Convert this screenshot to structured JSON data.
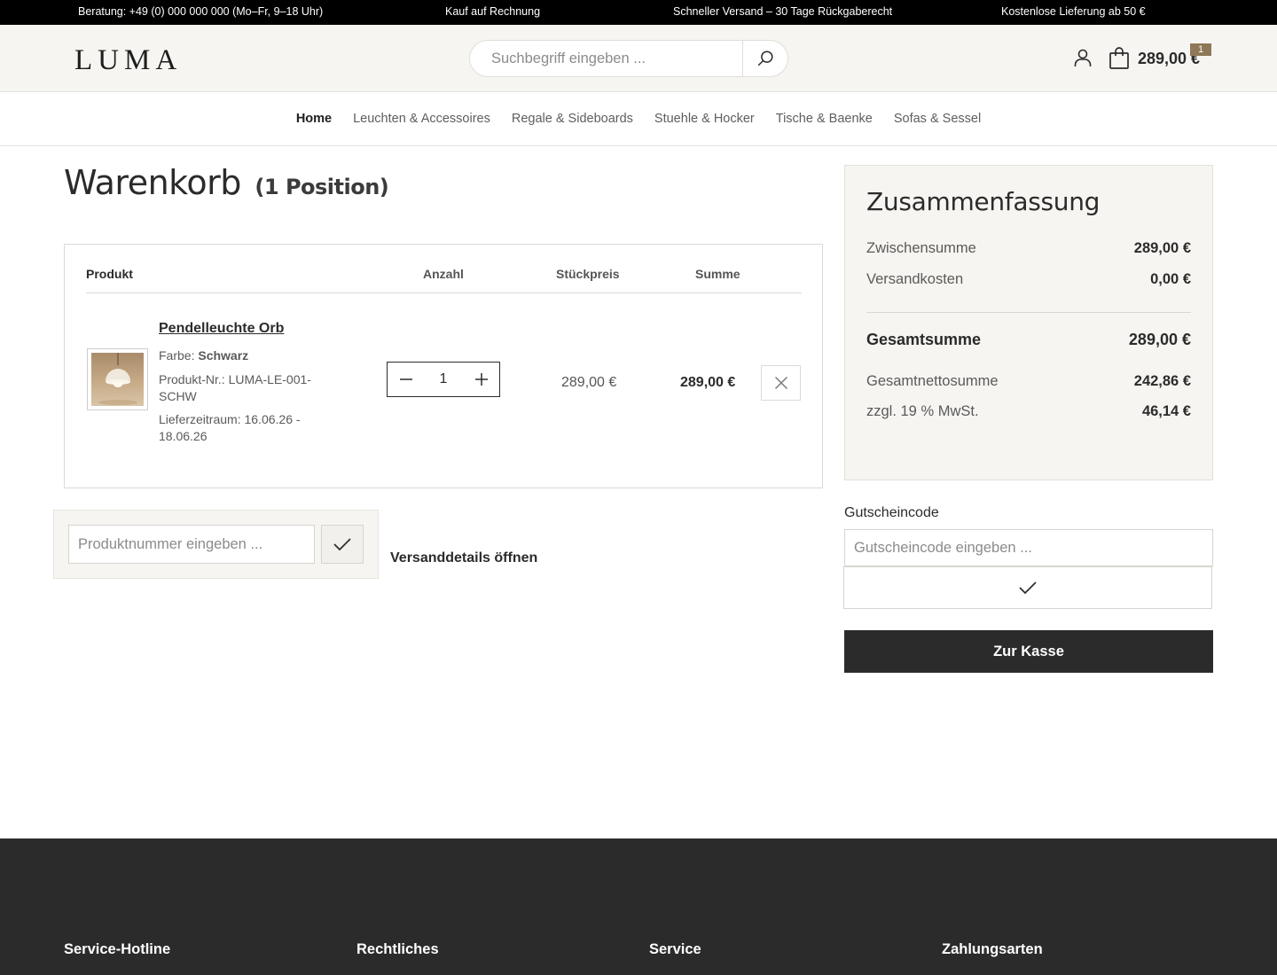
{
  "topbar": {
    "hotline": "Beratung: +49 (0) 000 000 000 (Mo–Fr, 9–18 Uhr)",
    "invoice": "Kauf auf Rechnung",
    "shipping": "Schneller Versand – 30 Tage Rückgaberecht",
    "free_delivery": "Kostenlose Lieferung ab 50 €"
  },
  "header": {
    "logo": "LUMA",
    "search_placeholder": "Suchbegriff eingeben ...",
    "cart_total": "289,00 €",
    "cart_badge": "1"
  },
  "nav": {
    "items": [
      {
        "label": "Home",
        "active": true
      },
      {
        "label": "Leuchten & Accessoires"
      },
      {
        "label": "Regale & Sideboards"
      },
      {
        "label": "Stuehle & Hocker"
      },
      {
        "label": "Tische & Baenke"
      },
      {
        "label": "Sofas & Sessel"
      }
    ]
  },
  "page": {
    "title": "Warenkorb",
    "count": "(1 Position)"
  },
  "cart": {
    "headers": {
      "product": "Produkt",
      "quantity": "Anzahl",
      "unit_price": "Stückpreis",
      "total": "Summe"
    },
    "items": [
      {
        "name": "Pendelleuchte Orb",
        "color_label": "Farbe:",
        "color_value": "Schwarz",
        "sku": "Produkt-Nr.: LUMA-LE-001-SCHW",
        "delivery": "Lieferzeitraum: 16.06.26 - 18.06.26",
        "quantity": "1",
        "unit_price": "289,00 €",
        "total": "289,00 €"
      }
    ]
  },
  "quick_add": {
    "placeholder": "Produktnummer eingeben ..."
  },
  "shipping_details_link": "Versanddetails öffnen",
  "summary": {
    "title": "Zusammenfassung",
    "subtotal_label": "Zwischensumme",
    "subtotal_value": "289,00 €",
    "shipping_label": "Versandkosten",
    "shipping_value": "0,00 €",
    "grand_total_label": "Gesamtsumme",
    "grand_total_value": "289,00 €",
    "net_label": "Gesamtnettosumme",
    "net_value": "242,86 €",
    "tax_label": "zzgl. 19 % MwSt.",
    "tax_value": "46,14 €"
  },
  "coupon": {
    "label": "Gutscheincode",
    "placeholder": "Gutscheincode eingeben ..."
  },
  "checkout_label": "Zur Kasse",
  "footer": {
    "columns": [
      "Service-Hotline",
      "Rechtliches",
      "Service",
      "Zahlungsarten"
    ]
  },
  "colors": {
    "accent": "#2b2b2b",
    "header_bg": "#f6f5f1",
    "badge": "#8e7857",
    "footer_bg": "#2b2b2b"
  }
}
